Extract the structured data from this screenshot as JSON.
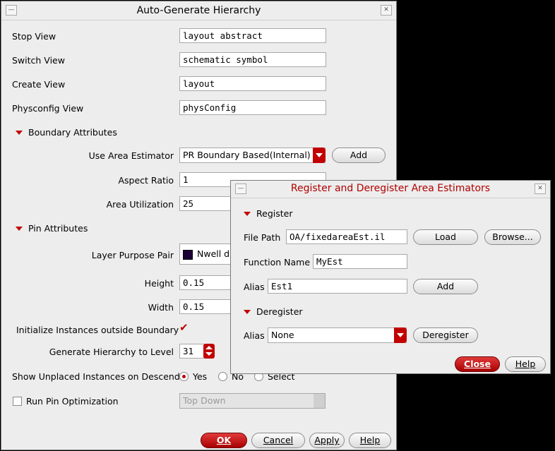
{
  "main_dialog": {
    "title": "Auto-Generate Hierarchy",
    "stop_view_label": "Stop View",
    "stop_view_value": "layout abstract",
    "switch_view_label": "Switch View",
    "switch_view_value": "schematic symbol",
    "create_view_label": "Create View",
    "create_view_value": "layout",
    "physconfig_view_label": "Physconfig View",
    "physconfig_view_value": "physConfig",
    "boundary_section": "Boundary Attributes",
    "area_estimator_label": "Use Area Estimator",
    "area_estimator_value": "PR Boundary Based(Internal)",
    "add_label": "Add",
    "aspect_ratio_label": "Aspect Ratio",
    "aspect_ratio_value": "1",
    "area_util_label": "Area Utilization",
    "area_util_value": "25",
    "pin_section": "Pin Attributes",
    "layer_purpose_label": "Layer Purpose Pair",
    "layer_purpose_value": "Nwell d",
    "height_label": "Height",
    "height_value": "0.15",
    "width_label": "Width",
    "width_value": "0.15",
    "init_instances_label": "Initialize Instances outside Boundary",
    "gen_level_label": "Generate Hierarchy to Level",
    "gen_level_value": "31",
    "show_unplaced_label": "Show Unplaced Instances on Descend",
    "radio_yes": "Yes",
    "radio_no": "No",
    "radio_select": "Select",
    "run_pin_label": "Run Pin Optimization",
    "pin_opt_value": "Top Down",
    "ok_label": "OK",
    "cancel_label": "Cancel",
    "apply_label": "Apply",
    "help_label": "Help"
  },
  "estimator_dialog": {
    "title": "Register and Deregister Area Estimators",
    "register_section": "Register",
    "file_path_label": "File Path",
    "file_path_value": "OA/fixedareaEst.il",
    "load_label": "Load",
    "browse_label": "Browse...",
    "function_name_label": "Function Name",
    "function_name_value": "MyEst",
    "alias_label": "Alias",
    "alias_value": "Est1",
    "add_label": "Add",
    "deregister_section": "Deregister",
    "dereg_alias_label": "Alias",
    "dereg_alias_value": "None",
    "deregister_label": "Deregister",
    "close_label": "Close",
    "help_label": "Help"
  },
  "colors": {
    "accent": "#c00000",
    "background": "#ededed",
    "title_red": "#b00000"
  },
  "icons": [
    "minimize-icon",
    "close-icon",
    "collapse-triangle-icon",
    "dropdown-arrow-icon",
    "spinner-icon",
    "checkmark-icon"
  ]
}
